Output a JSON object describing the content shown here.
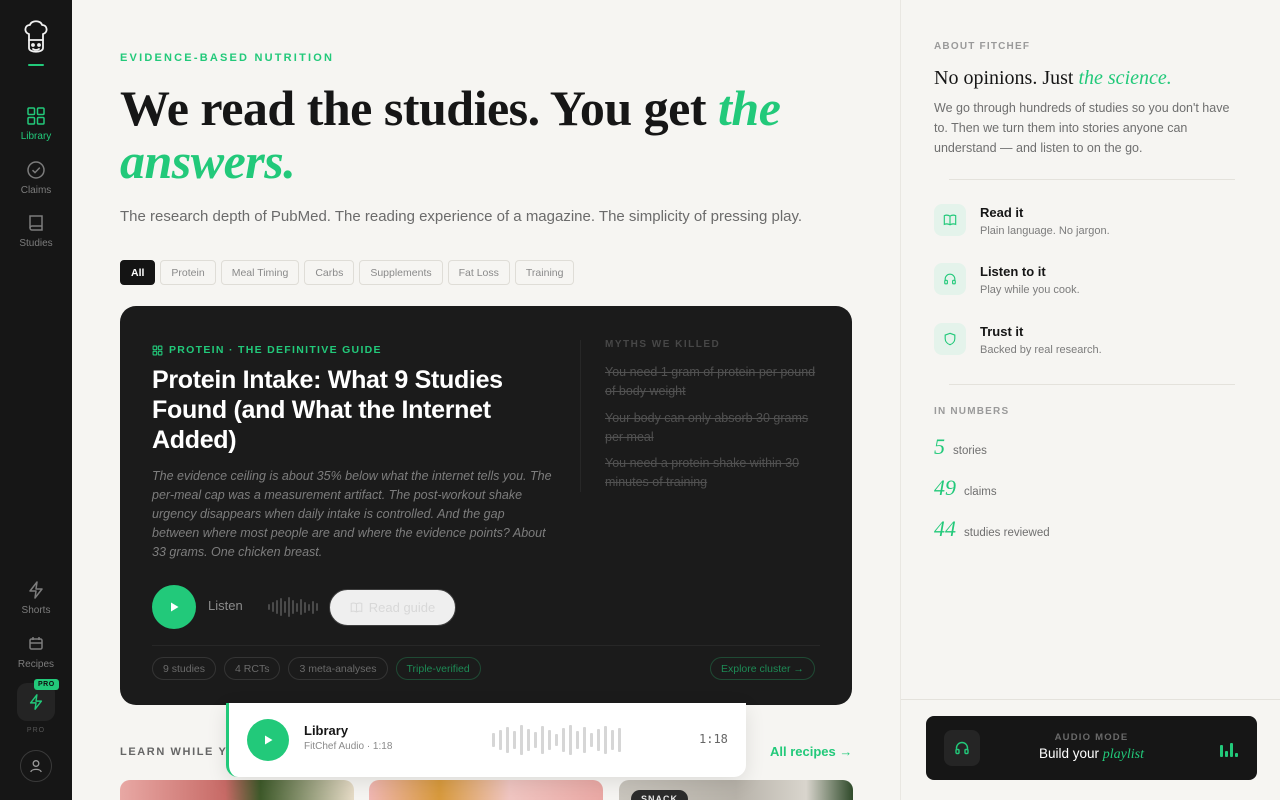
{
  "sidebar": {
    "items": [
      {
        "label": "Library",
        "icon": "grid-icon",
        "active": true
      },
      {
        "label": "Claims",
        "icon": "check-circle-icon",
        "active": false
      },
      {
        "label": "Studies",
        "icon": "book-icon",
        "active": false
      }
    ],
    "bottom_items": [
      {
        "label": "Shorts",
        "icon": "bolt-icon"
      },
      {
        "label": "Recipes",
        "icon": "calendar-icon"
      }
    ],
    "pro_badge": "PRO",
    "pro_label": "PRO",
    "accent": "#22c97a"
  },
  "main": {
    "eyebrow": "EVIDENCE-BASED NUTRITION",
    "hero_plain": "We read the studies. You get ",
    "hero_accent": "the answers.",
    "subtitle": "The research depth of PubMed. The reading experience of a magazine. The simplicity of pressing play.",
    "filters": [
      "All",
      "Protein",
      "Meal Timing",
      "Carbs",
      "Supplements",
      "Fat Loss",
      "Training"
    ],
    "active_filter": "All",
    "featured": {
      "tag": "PROTEIN · THE DEFINITIVE GUIDE",
      "title": "Protein Intake: What 9 Studies Found (and What the Internet Added)",
      "description": "The evidence ceiling is about 35% below what the internet tells you. The per-meal cap was a measurement artifact. The post-workout shake urgency disappears when daily intake is controlled. And the gap between where most people are and where the evidence points? About 33 grams. One chicken breast.",
      "listen_label": "Listen",
      "read_label": "Read guide",
      "myths_heading": "MYTHS WE KILLED",
      "myths": [
        "You need 1 gram of protein per pound of body weight",
        "Your body can only absorb 30 grams per meal",
        "You need a protein shake within 30 minutes of training"
      ],
      "meta": [
        "9 studies",
        "4 RCTs",
        "3 meta-analyses",
        "Triple-verified"
      ],
      "explore_label": "Explore cluster →"
    },
    "learn_heading": "LEARN WHILE YO",
    "all_recipes_label": "All recipes →",
    "thumb_tag": "SNACK"
  },
  "player": {
    "title": "Library",
    "subtitle": "FitChef Audio · 1:18",
    "time": "1:18"
  },
  "right": {
    "about_heading": "ABOUT FITCHEF",
    "about_title_plain": "No opinions. Just ",
    "about_title_accent": "the science.",
    "about_body": "We go through hundreds of studies so you don't have to. Then we turn them into stories anyone can understand — and listen to on the go.",
    "features": [
      {
        "title": "Read it",
        "desc": "Plain language. No jargon.",
        "icon": "book-open-icon"
      },
      {
        "title": "Listen to it",
        "desc": "Play while you cook.",
        "icon": "headphones-icon"
      },
      {
        "title": "Trust it",
        "desc": "Backed by real research.",
        "icon": "shield-icon"
      }
    ],
    "numbers_heading": "IN NUMBERS",
    "numbers": [
      {
        "value": "5",
        "label": "stories"
      },
      {
        "value": "49",
        "label": "claims"
      },
      {
        "value": "44",
        "label": "studies reviewed"
      }
    ],
    "audio_mode_label": "AUDIO MODE",
    "audio_build_plain": "Build your ",
    "audio_build_accent": "playlist"
  }
}
